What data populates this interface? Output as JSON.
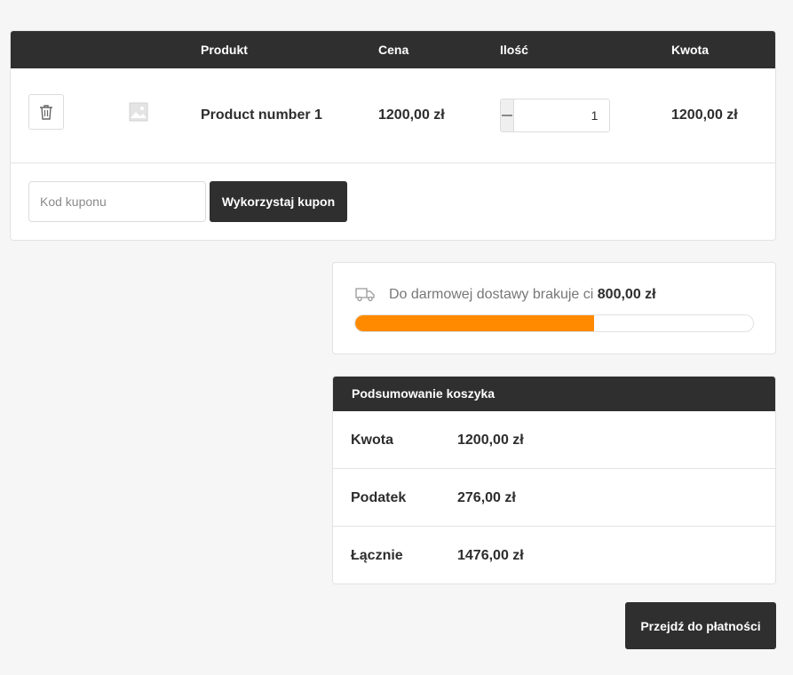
{
  "cart": {
    "headers": {
      "product": "Produkt",
      "price": "Cena",
      "quantity": "Ilość",
      "amount": "Kwota"
    },
    "items": [
      {
        "name": "Product number 1",
        "price": "1200,00 zł",
        "quantity": "1",
        "amount": "1200,00 zł"
      }
    ],
    "coupon": {
      "placeholder": "Kod kuponu",
      "button_label": "Wykorzystaj kupon"
    }
  },
  "shipping": {
    "text": "Do darmowej dostawy brakuje ci",
    "remaining": "800,00 zł",
    "progress_fraction": 0.6,
    "progress_color": "#ff8a00"
  },
  "summary": {
    "title": "Podsumowanie koszyka",
    "rows": [
      {
        "label": "Kwota",
        "value": "1200,00 zł"
      },
      {
        "label": "Podatek",
        "value": "276,00 zł"
      },
      {
        "label": "Łącznie",
        "value": "1476,00 zł"
      }
    ]
  },
  "checkout": {
    "button_label": "Przejdź do płatności"
  },
  "icons": {
    "delete": "trash-icon",
    "thumbnail": "image-placeholder-icon",
    "shipping": "truck-icon",
    "decrease": "minus-icon",
    "increase": "plus-icon"
  },
  "colors": {
    "dark": "#2f2f2f",
    "accent": "#ff8a00"
  }
}
